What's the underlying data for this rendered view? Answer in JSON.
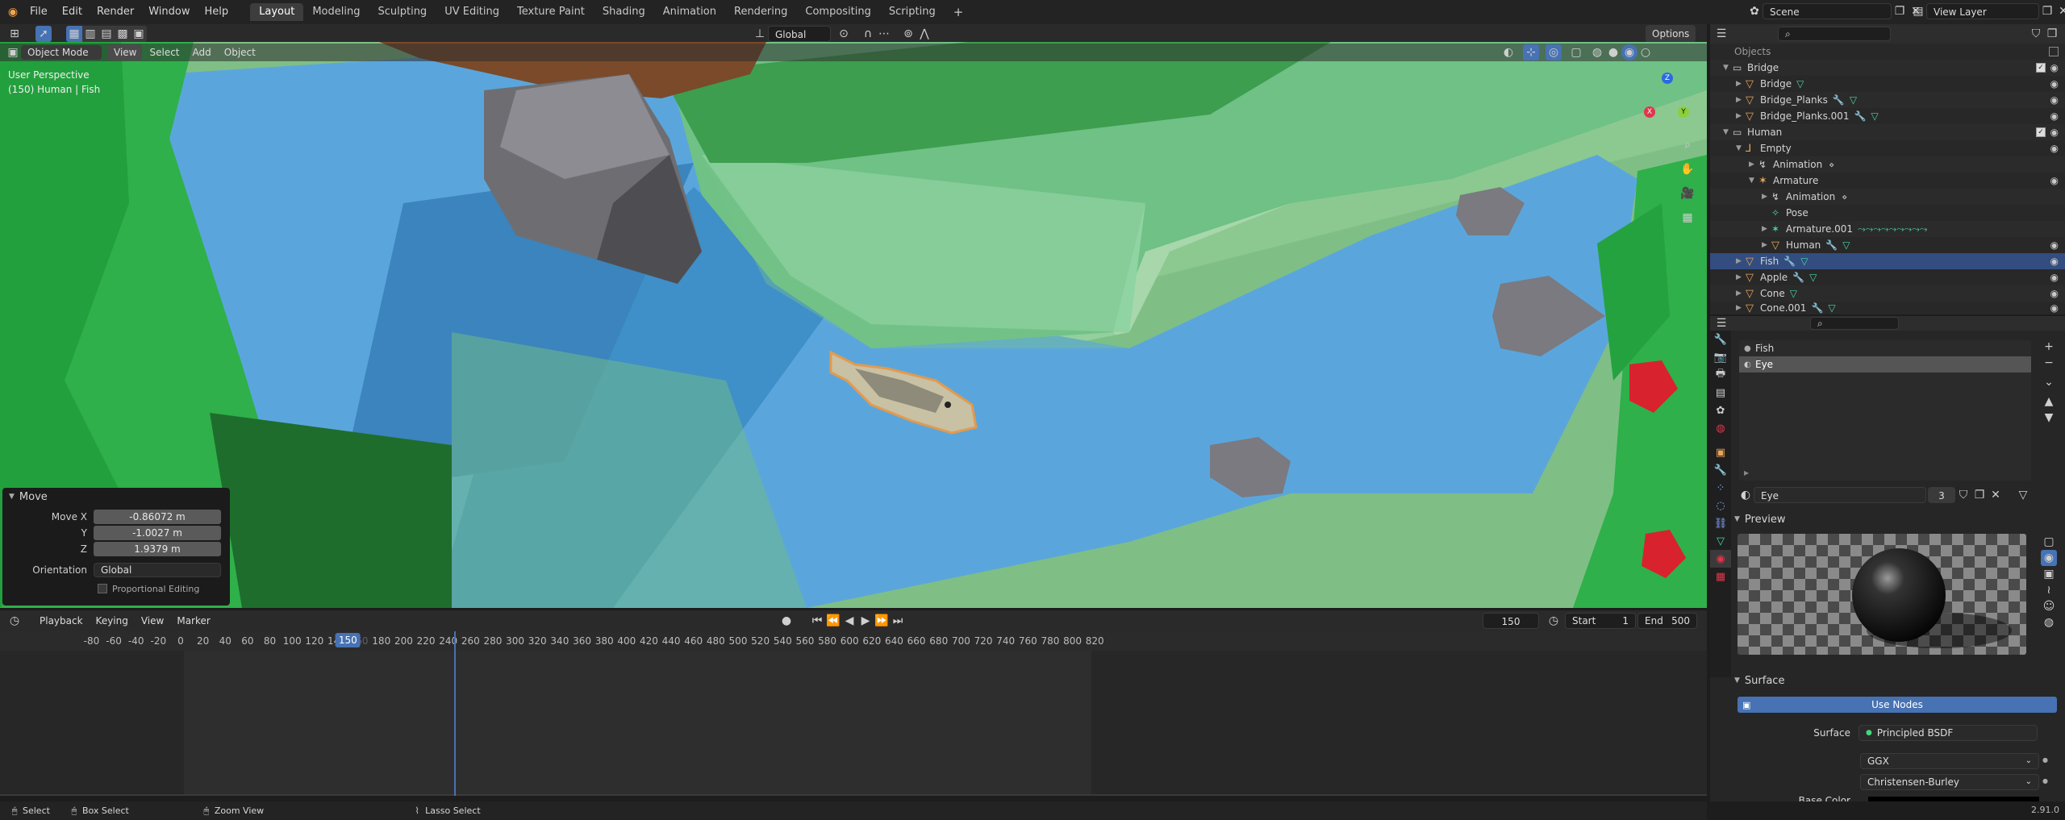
{
  "topbar": {
    "menus": [
      "File",
      "Edit",
      "Render",
      "Window",
      "Help"
    ],
    "workspaces": [
      "Layout",
      "Modeling",
      "Sculpting",
      "UV Editing",
      "Texture Paint",
      "Shading",
      "Animation",
      "Rendering",
      "Compositing",
      "Scripting"
    ],
    "active_workspace": "Layout",
    "add_tab": "+",
    "scene": "Scene",
    "view_layer": "View Layer"
  },
  "viewport_header": {
    "mode": "Object Mode",
    "menus": [
      "View",
      "Select",
      "Add",
      "Object"
    ],
    "transform_orientation": "Global",
    "options": "Options"
  },
  "viewport": {
    "perspective": "User Perspective",
    "object_info": "(150) Human | Fish",
    "gizmo": {
      "z": "Z",
      "x": "X",
      "y": "Y"
    }
  },
  "move_panel": {
    "title": "Move",
    "fields": [
      {
        "label": "Move X",
        "value": "-0.86072 m"
      },
      {
        "label": "Y",
        "value": "-1.0027 m"
      },
      {
        "label": "Z",
        "value": "1.9379 m"
      }
    ],
    "orientation_label": "Orientation",
    "orientation_value": "Global",
    "proportional_editing": "Proportional Editing"
  },
  "timeline": {
    "menus": [
      "Playback",
      "Keying",
      "View",
      "Marker"
    ],
    "current_frame": "150",
    "start_label": "Start",
    "start": "1",
    "end_label": "End",
    "end": "500",
    "ruler": [
      "-80",
      "-60",
      "-40",
      "-20",
      "0",
      "20",
      "40",
      "60",
      "80",
      "100",
      "120",
      "140",
      "150",
      "160",
      "180",
      "200",
      "220",
      "240",
      "260",
      "280",
      "300",
      "320",
      "340",
      "360",
      "380",
      "400",
      "420",
      "440",
      "460",
      "480",
      "500",
      "520",
      "540",
      "560",
      "580",
      "600",
      "620",
      "640",
      "660",
      "680",
      "700",
      "720",
      "740",
      "760",
      "780",
      "800",
      "820"
    ]
  },
  "statusbar": {
    "items": [
      "Select",
      "Box Select",
      "Zoom View",
      "Lasso Select"
    ],
    "version": "2.91.0"
  },
  "outliner": {
    "header_label": "Objects",
    "rows": [
      {
        "label": "Bridge",
        "indent": 0,
        "kind": "collection"
      },
      {
        "label": "Bridge",
        "indent": 1,
        "kind": "object"
      },
      {
        "label": "Bridge_Planks",
        "indent": 1,
        "kind": "object"
      },
      {
        "label": "Bridge_Planks.001",
        "indent": 1,
        "kind": "object"
      },
      {
        "label": "Human",
        "indent": 0,
        "kind": "collection"
      },
      {
        "label": "Empty",
        "indent": 1,
        "kind": "empty"
      },
      {
        "label": "Animation",
        "indent": 2,
        "kind": "anim"
      },
      {
        "label": "Armature",
        "indent": 2,
        "kind": "armature"
      },
      {
        "label": "Animation",
        "indent": 3,
        "kind": "anim"
      },
      {
        "label": "Pose",
        "indent": 3,
        "kind": "pose"
      },
      {
        "label": "Armature.001",
        "indent": 3,
        "kind": "armature"
      },
      {
        "label": "Human",
        "indent": 3,
        "kind": "object"
      },
      {
        "label": "Fish",
        "indent": 1,
        "kind": "object",
        "selected": true
      },
      {
        "label": "Apple",
        "indent": 1,
        "kind": "object"
      },
      {
        "label": "Cone",
        "indent": 1,
        "kind": "object"
      },
      {
        "label": "Cone.001",
        "indent": 1,
        "kind": "object"
      }
    ]
  },
  "properties": {
    "material_slots": [
      "Fish",
      "Eye"
    ],
    "material_count": "3",
    "material_name": "Eye",
    "preview_label": "Preview",
    "surface_label": "Surface",
    "use_nodes": "Use Nodes",
    "surface_field_label": "Surface",
    "surface_value": "Principled BSDF",
    "distribution": "GGX",
    "subsurface_method": "Christensen-Burley",
    "base_color_label": "Base Color"
  },
  "colors": {
    "selection": "#334d80",
    "accent_blue": "#4772b3",
    "object_orange": "#e8a65a",
    "mesh_green": "#46d6a4"
  }
}
